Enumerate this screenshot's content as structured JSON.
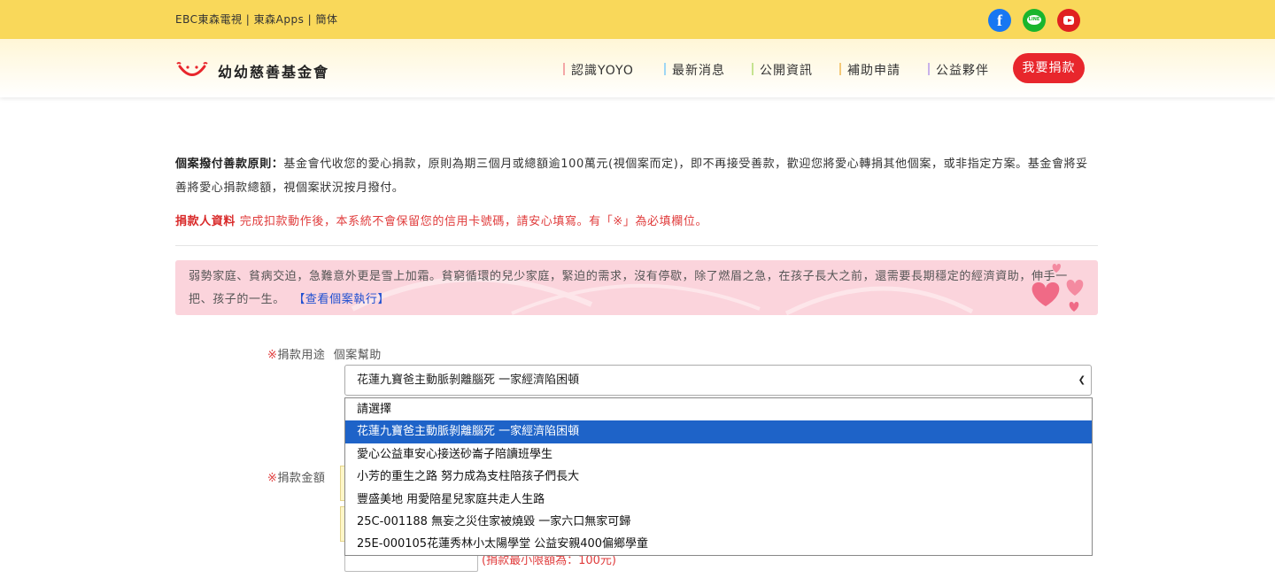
{
  "topbar": {
    "links": "EBC東森電視 | 東森Apps | 簡体",
    "social_icons": [
      "facebook-icon",
      "line-icon",
      "youtube-icon"
    ],
    "facebook_glyph": "f",
    "line_glyph": "LINE",
    "color": "#f9d85a"
  },
  "header": {
    "logo_text": "幼幼慈善基金會",
    "nav": [
      "認識YOYO",
      "最新消息",
      "公開資訊",
      "補助申請",
      "公益夥伴"
    ],
    "donate_button": "我要捐款",
    "donate_color": "#e8262c"
  },
  "content": {
    "principle_title": "個案撥付善款原則：",
    "principle_body": "基金會代收您的愛心捐款，原則為期三個月或總額逾100萬元(視個案而定)，即不再接受善款，歡迎您將愛心轉捐其他個案，或非指定方案。基金會將妥善將愛心捐款總額，視個案狀況按月撥付。",
    "donor_title": "捐款人資料",
    "donor_notice": "完成扣款動作後，本系統不會保留您的信用卡號碼，請安心填寫。有「※」為必填欄位。",
    "pink_text": "弱勢家庭、貧病交迫，急難意外更是雪上加霜。貧窮循環的兒少家庭，緊迫的需求，沒有停歇，除了燃眉之急，在孩子長大之前，還需要長期穩定的經濟資助，伸手一把、孩子的一生。",
    "pink_link": "【查看個案執行】"
  },
  "form": {
    "required_mark": "※",
    "purpose_label": "捐款用途",
    "purpose_value": "個案幫助",
    "amount_label": "捐款金額",
    "select_value": "花蓮九寶爸主動脈剝離腦死 一家經濟陷困頓",
    "options": [
      "請選擇",
      "花蓮九寶爸主動脈剝離腦死 一家經濟陷困頓",
      "愛心公益車安心接送砂崙子陪讀班學生",
      "小芳的重生之路 努力成為支柱陪孩子們長大",
      "豐盛美地 用愛陪星兒家庭共走人生路",
      "25C-001188 無妄之災住家被燒毀 一家六口無家可歸",
      "25E-000105花蓮秀林小太陽學堂 公益安親400偏鄉學童"
    ],
    "selected_index": 1,
    "min_amount_hint": "(捐款最小限額為：100元)"
  }
}
